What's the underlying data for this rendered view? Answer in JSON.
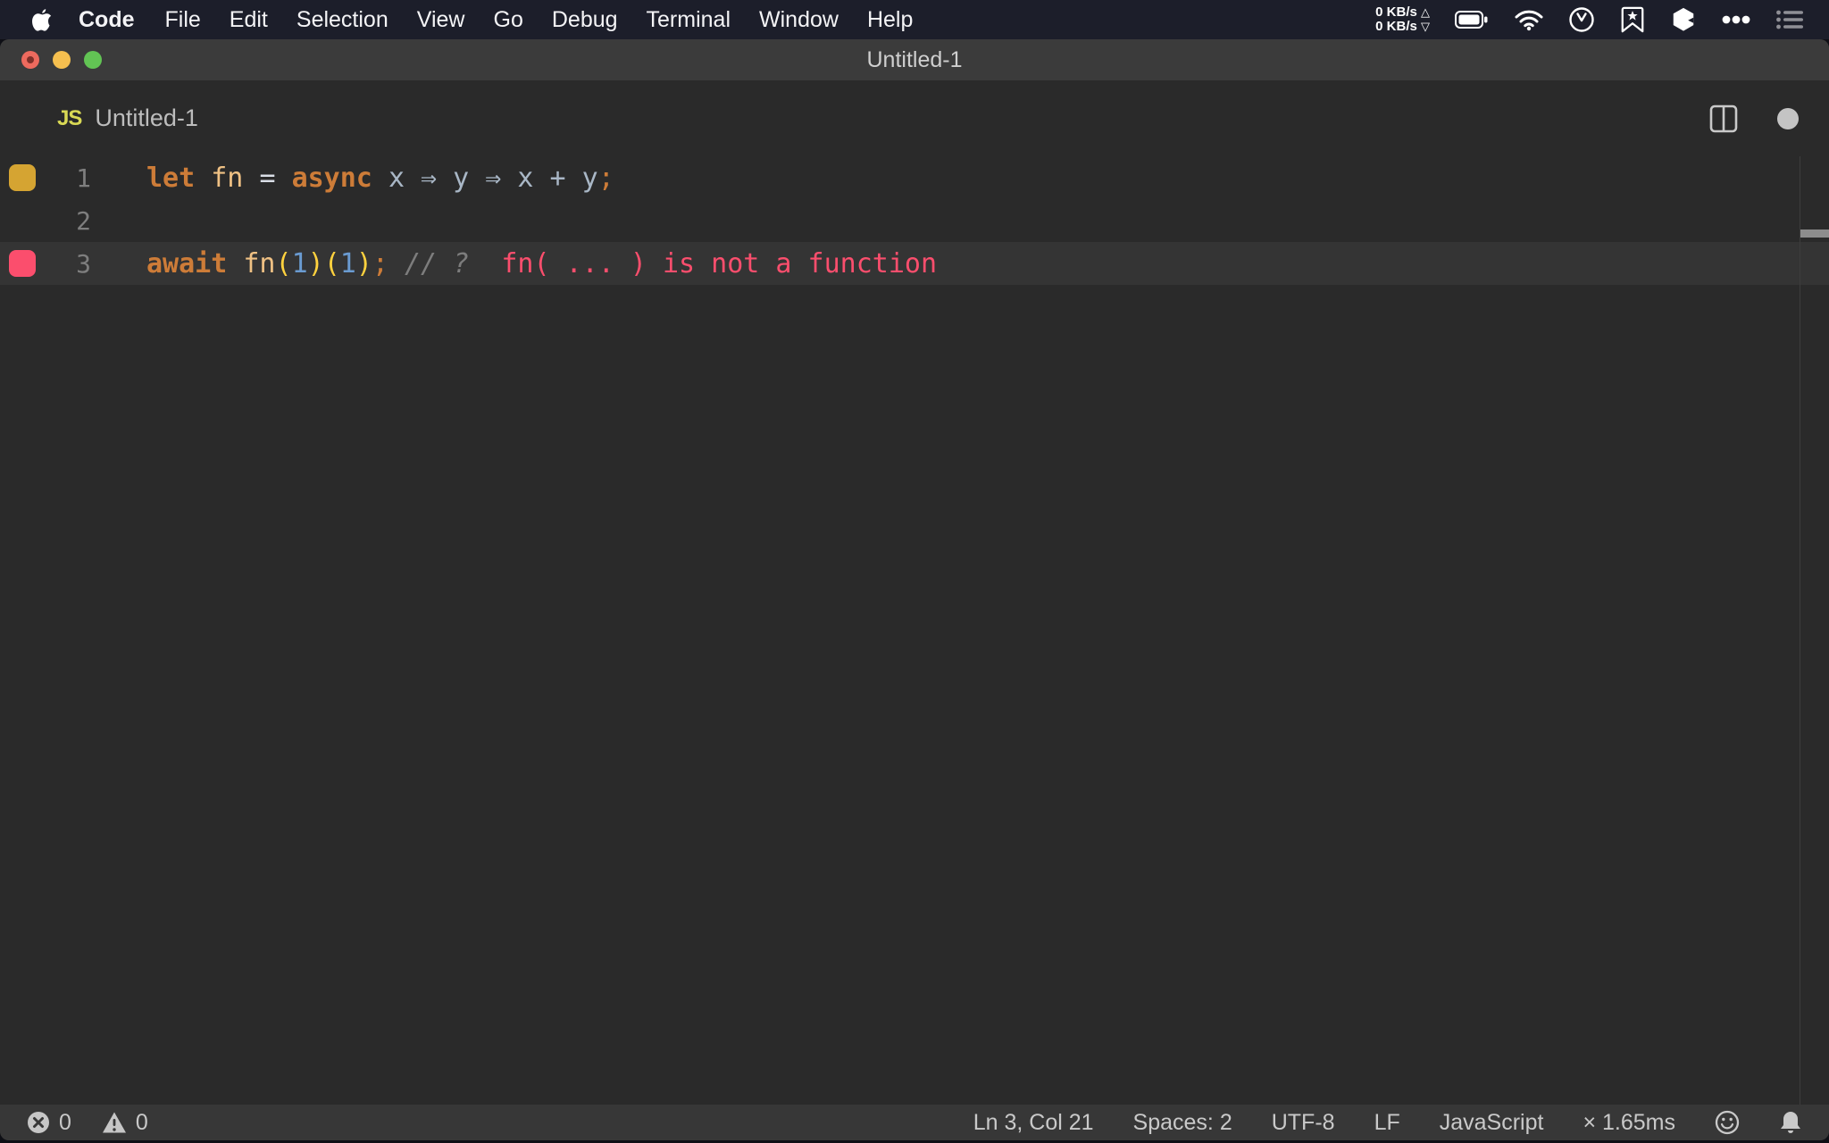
{
  "menubar": {
    "apple_icon": "apple-logo",
    "items": [
      "Code",
      "File",
      "Edit",
      "Selection",
      "View",
      "Go",
      "Debug",
      "Terminal",
      "Window",
      "Help"
    ],
    "active_app": "Code",
    "net": {
      "up": "0 KB/s",
      "down": "0 KB/s",
      "up_glyph": "△",
      "down_glyph": "▽"
    },
    "status_icons": [
      "battery-icon",
      "wifi-icon",
      "clock-icon",
      "bookmark-icon",
      "cube-icon",
      "ellipsis-icon",
      "list-icon"
    ]
  },
  "window": {
    "title": "Untitled-1",
    "traffic_lights": [
      "close",
      "minimize",
      "zoom"
    ]
  },
  "editor_header": {
    "badge": "JS",
    "filename": "Untitled-1",
    "actions": [
      "split-editor-icon",
      "dirty-dot"
    ]
  },
  "editor": {
    "lines": [
      {
        "number": "1",
        "marker": "#d5a432",
        "highlight": false,
        "tokens": [
          {
            "t": "let",
            "c": "kw"
          },
          {
            "t": " ",
            "c": "plain"
          },
          {
            "t": "fn",
            "c": "fn"
          },
          {
            "t": " ",
            "c": "plain"
          },
          {
            "t": "=",
            "c": "eq"
          },
          {
            "t": " ",
            "c": "plain"
          },
          {
            "t": "async",
            "c": "kw"
          },
          {
            "t": " ",
            "c": "plain"
          },
          {
            "t": "x ⇒ y ⇒ x + y",
            "c": "var"
          },
          {
            "t": ";",
            "c": "semi"
          }
        ]
      },
      {
        "number": "2",
        "marker": null,
        "highlight": false,
        "tokens": []
      },
      {
        "number": "3",
        "marker": "#fb4e6d",
        "highlight": true,
        "tokens": [
          {
            "t": "await",
            "c": "kw"
          },
          {
            "t": " ",
            "c": "plain"
          },
          {
            "t": "fn",
            "c": "fn"
          },
          {
            "t": "(",
            "c": "paren"
          },
          {
            "t": "1",
            "c": "num"
          },
          {
            "t": ")",
            "c": "paren"
          },
          {
            "t": "(",
            "c": "paren"
          },
          {
            "t": "1",
            "c": "num"
          },
          {
            "t": ")",
            "c": "paren"
          },
          {
            "t": ";",
            "c": "semi"
          },
          {
            "t": " ",
            "c": "plain"
          },
          {
            "t": "// ?",
            "c": "comment"
          },
          {
            "t": "  ",
            "c": "plain"
          },
          {
            "t": "fn( ... ) is not a function",
            "c": "error"
          }
        ]
      }
    ]
  },
  "statusbar": {
    "errors": "0",
    "warnings": "0",
    "items": [
      "Ln 3, Col 21",
      "Spaces: 2",
      "UTF-8",
      "LF",
      "JavaScript",
      "× 1.65ms"
    ],
    "icons": [
      "smiley-icon",
      "bell-icon"
    ]
  },
  "colors": {
    "menubar_bg": "#1c1e2a",
    "titlebar_bg": "#3b3b3b",
    "editor_bg": "#2a2a2a",
    "line_highlight": "#343434",
    "statusbar_bg": "#373737",
    "keyword_orange": "#cd7c38",
    "paren_yellow": "#ffd23e",
    "number_blue": "#6a9bd1",
    "error_pink": "#fb4e6d",
    "marker_gold": "#d5a432"
  }
}
